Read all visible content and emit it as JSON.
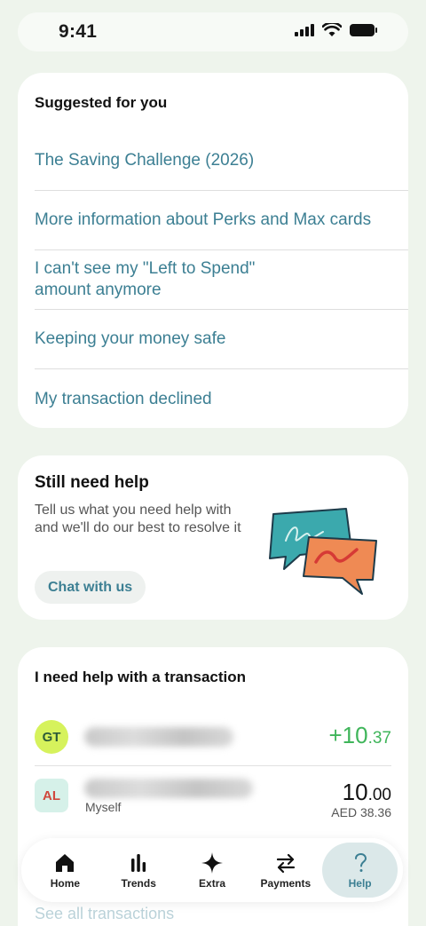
{
  "status_bar": {
    "time": "9:41"
  },
  "suggested": {
    "heading": "Suggested for you",
    "items": [
      "The Saving Challenge (2026)",
      "More information about Perks and Max cards",
      "I can't see my \"Left to Spend\"\namount anymore",
      "Keeping your money safe",
      "My transaction declined"
    ]
  },
  "help": {
    "title": "Still need help",
    "description": "Tell us what you need help with and we'll do our best to resolve it",
    "chat_button": "Chat with us"
  },
  "transactions": {
    "heading": "I need help with a transaction",
    "rows": [
      {
        "initials": "GT",
        "amount_sign": "+",
        "amount_main": "10",
        "amount_dec": ".37"
      },
      {
        "initials": "AL",
        "sub_label": "Myself",
        "amount_main": "10",
        "amount_dec": ".00",
        "sub_amount": "AED 38.36"
      }
    ],
    "see_all": "See all transactions"
  },
  "nav": {
    "items": [
      {
        "label": "Home",
        "icon": "home-icon"
      },
      {
        "label": "Trends",
        "icon": "trends-icon"
      },
      {
        "label": "Extra",
        "icon": "sparkle-icon"
      },
      {
        "label": "Payments",
        "icon": "transfer-icon"
      },
      {
        "label": "Help",
        "icon": "question-icon",
        "active": true
      }
    ]
  },
  "colors": {
    "accent": "#3c7f93",
    "positive": "#3fb55a",
    "background": "#eef4ec"
  }
}
